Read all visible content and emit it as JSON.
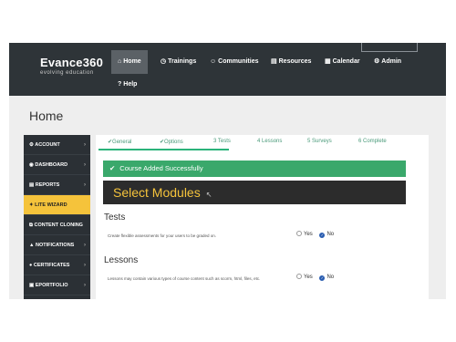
{
  "brand": {
    "name": "Evance360",
    "tagline": "evolving education"
  },
  "nav": [
    {
      "icon": "home-icon",
      "glyph": "⌂",
      "label": "Home",
      "active": true
    },
    {
      "icon": "clock-icon",
      "glyph": "◷",
      "label": "Trainings",
      "active": false
    },
    {
      "icon": "users-icon",
      "glyph": "☺",
      "label": "Communities",
      "active": false
    },
    {
      "icon": "folder-icon",
      "glyph": "▤",
      "label": "Resources",
      "active": false
    },
    {
      "icon": "calendar-icon",
      "glyph": "▦",
      "label": "Calendar",
      "active": false
    },
    {
      "icon": "gear-icon",
      "glyph": "⚙",
      "label": "Admin",
      "active": false
    },
    {
      "icon": "question-icon",
      "glyph": "?",
      "label": "Help",
      "active": false
    }
  ],
  "page_title": "Home",
  "sidebar": [
    {
      "label": "ACCOUNT",
      "icon": "account-icon",
      "glyph": "⚙",
      "active": false
    },
    {
      "label": "DASHBOARD",
      "icon": "dashboard-icon",
      "glyph": "◉",
      "active": false
    },
    {
      "label": "REPORTS",
      "icon": "reports-icon",
      "glyph": "▤",
      "active": false
    },
    {
      "label": "LITE WIZARD",
      "icon": "wand-icon",
      "glyph": "✦",
      "active": true
    },
    {
      "label": "CONTENT CLONING",
      "icon": "clone-icon",
      "glyph": "⧉",
      "active": false
    },
    {
      "label": "NOTIFICATIONS",
      "icon": "bell-icon",
      "glyph": "▲",
      "active": false
    },
    {
      "label": "CERTIFICATES",
      "icon": "certificate-icon",
      "glyph": "●",
      "active": false
    },
    {
      "label": "EPORTFOLIO",
      "icon": "portfolio-icon",
      "glyph": "▣",
      "active": false
    }
  ],
  "steps": [
    {
      "prefix": "✔",
      "label": "General"
    },
    {
      "prefix": "✔",
      "label": "Options"
    },
    {
      "prefix": "3",
      "label": "Tests"
    },
    {
      "prefix": "4",
      "label": "Lessons"
    },
    {
      "prefix": "5",
      "label": "Surveys"
    },
    {
      "prefix": "6",
      "label": "Complete"
    }
  ],
  "progress": 0.4,
  "alert": "Course Added Successfully",
  "module_heading": "Select Modules",
  "sections": [
    {
      "title": "Tests",
      "description": "Create flexible assessments for your users to be graded on.",
      "yes": "Yes",
      "no": "No",
      "selected": "No"
    },
    {
      "title": "Lessons",
      "description": "Lessons may contain various types of course content such as scorm, html, files, etc.",
      "yes": "Yes",
      "no": "No",
      "selected": "No"
    }
  ],
  "colors": {
    "topbar": "#2e3438",
    "accent": "#f5c33b",
    "success": "#3aa86b"
  }
}
